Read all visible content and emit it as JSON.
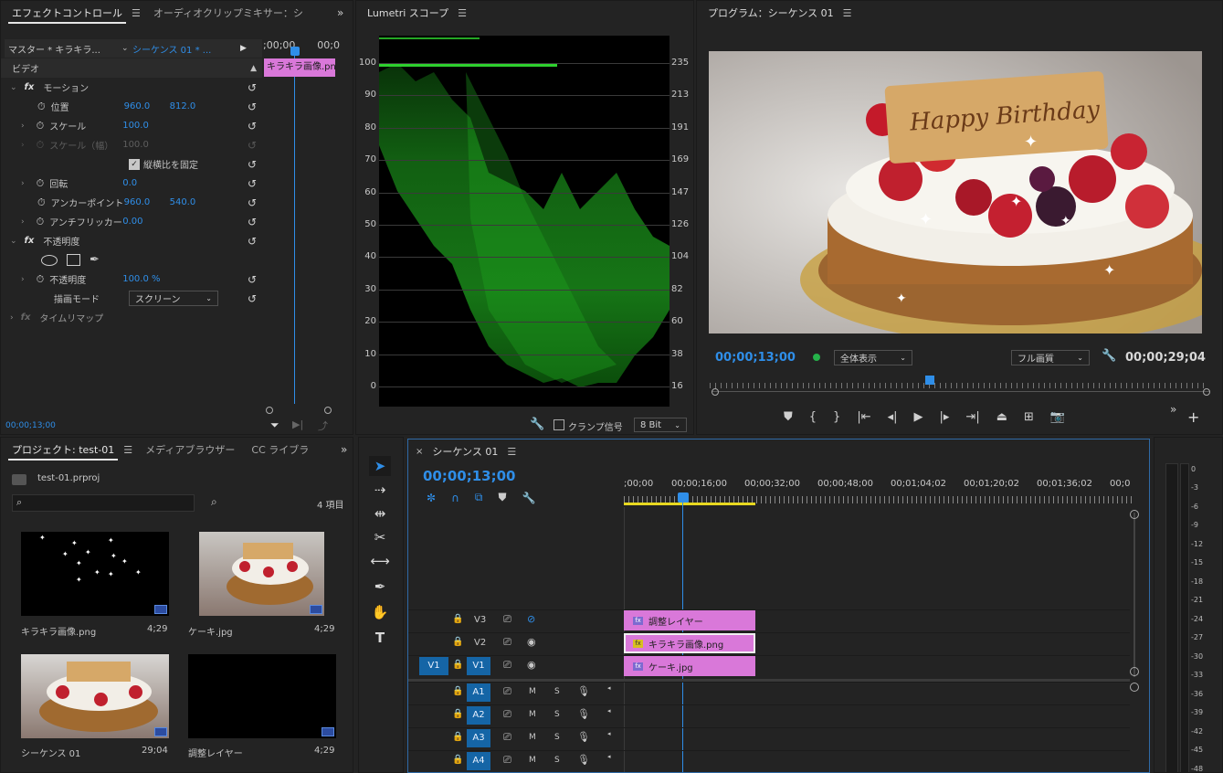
{
  "effect_controls": {
    "tabs": [
      "エフェクトコントロール",
      "オーディオクリップミキサー：シ"
    ],
    "master_label": "マスター * キラキラ...",
    "sequence_label": "シーケンス 01 * ...",
    "mini_ruler": [
      ";00;00",
      "00;0"
    ],
    "clip_label": "キラキラ画像.pn",
    "section_video": "ビデオ",
    "motion": "モーション",
    "properties": {
      "position": {
        "label": "位置",
        "x": "960.0",
        "y": "812.0"
      },
      "scale": {
        "label": "スケール",
        "value": "100.0"
      },
      "scale_width": {
        "label": "スケール（幅）",
        "value": "100.0"
      },
      "uniform_scale": "縦横比を固定",
      "rotation": {
        "label": "回転",
        "value": "0.0"
      },
      "anchor": {
        "label": "アンカーポイント",
        "x": "960.0",
        "y": "540.0"
      },
      "antiflicker": {
        "label": "アンチフリッカー",
        "value": "0.00"
      },
      "opacity_section": "不透明度",
      "opacity": {
        "label": "不透明度",
        "value": "100.0 %"
      },
      "blend_mode": {
        "label": "描画モード",
        "value": "スクリーン"
      },
      "time_remap": "タイムリマップ"
    },
    "fx_symbol": "fx",
    "timecode": "00;00;13;00"
  },
  "lumetri": {
    "title": "Lumetri スコープ",
    "left_scale": [
      "100",
      "90",
      "80",
      "70",
      "60",
      "50",
      "40",
      "30",
      "20",
      "10",
      "0"
    ],
    "right_scale": [
      "235",
      "213",
      "191",
      "169",
      "147",
      "126",
      "104",
      "82",
      "60",
      "38",
      "16"
    ],
    "clamp_label": "クランプ信号",
    "bit_depth": "8 Bit"
  },
  "program": {
    "title": "プログラム：シーケンス 01",
    "cake_text": "Happy Birthday",
    "timecode": "00;00;13;00",
    "fit_label": "全体表示",
    "quality_label": "フル画質",
    "duration": "00;00;29;04"
  },
  "project": {
    "tabs": [
      "プロジェクト: test-01",
      "メディアブラウザー",
      "CC ライブラ"
    ],
    "file": "test-01.prproj",
    "item_count": "4 項目",
    "search_placeholder": "",
    "items": [
      {
        "name": "キラキラ画像.png",
        "duration": "4;29"
      },
      {
        "name": "ケーキ.jpg",
        "duration": "4;29"
      },
      {
        "name": "シーケンス 01",
        "duration": "29;04"
      },
      {
        "name": "調整レイヤー",
        "duration": "4;29"
      }
    ]
  },
  "timeline": {
    "close": "×",
    "title": "シーケンス 01",
    "timecode": "00;00;13;00",
    "ruler": [
      ";00;00",
      "00;00;16;00",
      "00;00;32;00",
      "00;00;48;00",
      "00;01;04;02",
      "00;01;20;02",
      "00;01;36;02",
      "00;0"
    ],
    "video_tracks": [
      "V3",
      "V2",
      "V1"
    ],
    "source_patch": "V1",
    "audio_tracks": [
      "A1",
      "A2",
      "A3",
      "A4"
    ],
    "mute": "M",
    "solo": "S",
    "clips": [
      "調整レイヤー",
      "キラキラ画像.png",
      "ケーキ.jpg"
    ]
  },
  "meter": {
    "labels": [
      "0",
      "-3",
      "-6",
      "-9",
      "-12",
      "-15",
      "-18",
      "-21",
      "-24",
      "-27",
      "-30",
      "-33",
      "-36",
      "-39",
      "-42",
      "-45",
      "-48"
    ]
  },
  "colors": {
    "accent_blue": "#2f8ee8",
    "clip_pink": "#d978d9",
    "scope_green": "#1fa81f",
    "selected_track": "#1565a6"
  }
}
